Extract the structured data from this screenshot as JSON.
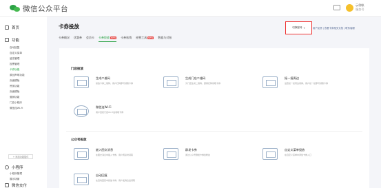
{
  "header": {
    "app_name": "微信公众平台",
    "user_name": "示例帐",
    "user_sub": "服务号"
  },
  "sidebar": {
    "home": "首页",
    "func_section": "功能",
    "items": [
      "自动回复",
      "自定义菜单",
      "留言管理",
      "投票管理",
      "卡券功能",
      "原创声明功能",
      "页面模版",
      "赞赏功能",
      "页面模版",
      "营销功能",
      "门店小程序",
      "微信连Wi-Fi"
    ],
    "add_plugin": "+ 添加功能插件",
    "miniprogram_section": "小程序",
    "mp_items": [
      "小程序管理",
      "展示场景"
    ],
    "pay_section": "微信支付"
  },
  "page": {
    "title": "卡券投放",
    "tabs": [
      {
        "label": "卡券概况"
      },
      {
        "label": "优惠券"
      },
      {
        "label": "会员卡"
      },
      {
        "label": "卡券投放",
        "badge": "NEW"
      },
      {
        "label": "卡券核销"
      },
      {
        "label": "经营工具",
        "badge": "NEW"
      },
      {
        "label": "数据与对账"
      }
    ],
    "account_select": "切换账号",
    "links": "用户反馈 | 查看卡券相关文档 | 联系客服"
  },
  "sections": [
    {
      "title": "门店投放",
      "cards": [
        {
          "title": "生成二维码",
          "desc": "投放卡券二维码，用户扫码即可领取卡券"
        },
        {
          "title": "生成门店二维码",
          "desc": "为门店生成二维码，顾客扫码领取卡券"
        },
        {
          "title": "摇一摇周边",
          "desc": "设置摇一摇周边领券，用户摇一摇即可领取卡券"
        },
        {
          "title": "微信连Wi-Fi",
          "desc": "用户连接门店Wi-Fi后领取卡券"
        }
      ]
    },
    {
      "title": "公众号投放",
      "cards": [
        {
          "title": "嵌入图文消息",
          "desc": "在图文消息中插入卡券，用户阅读时领取"
        },
        {
          "title": "群发卡券",
          "desc": "通过公众号群发卡券给粉丝"
        },
        {
          "title": "自定义菜单投放",
          "desc": "在自定义菜单中添加卡券入口"
        },
        {
          "title": "自动回复",
          "desc": "在自动回复中投放卡券，用户发消息后领取"
        }
      ]
    }
  ]
}
